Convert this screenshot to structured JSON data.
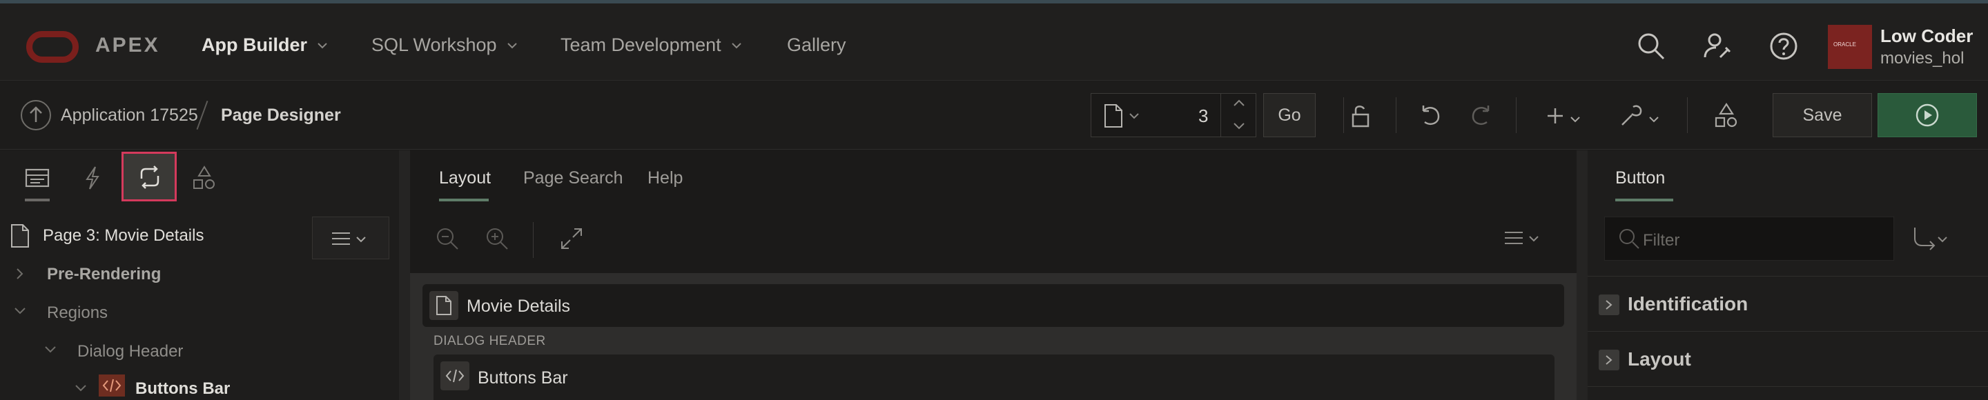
{
  "header": {
    "logo_text": "APEX",
    "nav": [
      {
        "label": "App Builder",
        "has_caret": true,
        "active": true
      },
      {
        "label": "SQL Workshop",
        "has_caret": true,
        "active": false
      },
      {
        "label": "Team Development",
        "has_caret": true,
        "active": false
      },
      {
        "label": "Gallery",
        "has_caret": false,
        "active": false
      }
    ],
    "icons": [
      "search-icon",
      "user-settings-icon",
      "help-icon"
    ],
    "user": {
      "name": "Low Coder",
      "workspace": "movies_hol",
      "avatar_text": "ORACLE"
    }
  },
  "toolbar": {
    "breadcrumb": [
      "Application 17525",
      "Page Designer"
    ],
    "page_number": "3",
    "go_label": "Go",
    "save_label": "Save",
    "icons": [
      "page-icon",
      "lock-icon",
      "undo-icon",
      "redo-icon",
      "add-icon",
      "wrench-icon",
      "shared-components-icon",
      "run-icon"
    ]
  },
  "left_panel": {
    "tabs": [
      "rendering-tab",
      "dynamic-actions-tab",
      "processing-tab",
      "shared-components-tab"
    ],
    "tree": [
      {
        "label": "Page 3: Movie Details",
        "level": 0
      },
      {
        "label": "Pre-Rendering",
        "level": 1
      },
      {
        "label": "Regions",
        "level": 1
      },
      {
        "label": "Dialog Header",
        "level": 2
      },
      {
        "label": "Buttons Bar",
        "level": 3
      }
    ]
  },
  "center": {
    "tabs": [
      "Layout",
      "Page Search",
      "Help"
    ],
    "active_tab": "Layout",
    "region_title": "Movie Details",
    "section_label": "DIALOG HEADER",
    "sub_region_title": "Buttons Bar"
  },
  "right_panel": {
    "tab": "Button",
    "filter_placeholder": "Filter",
    "sections": [
      "Identification",
      "Layout"
    ]
  },
  "colors": {
    "accent_red": "#7a1f1c",
    "run_green": "#2a5a3b",
    "selection": "#d43a5c"
  }
}
